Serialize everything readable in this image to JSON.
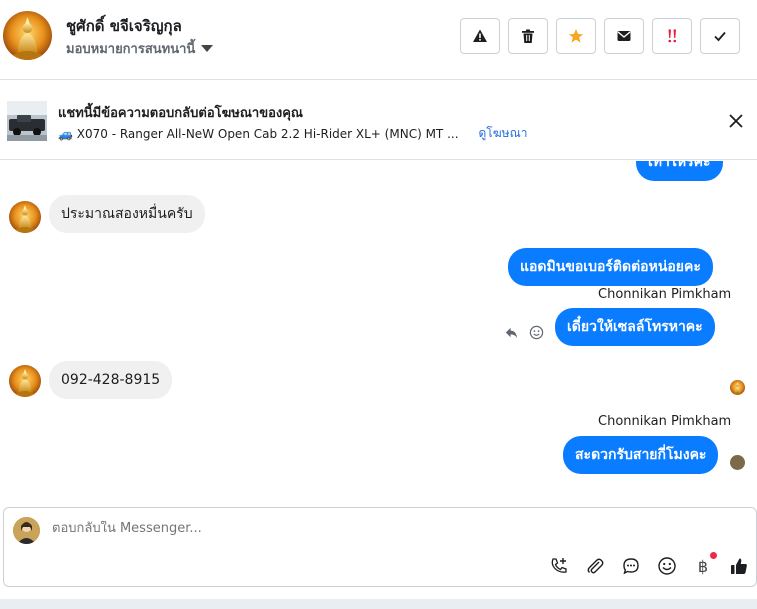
{
  "header": {
    "contact_name": "ชูศักดิ์ ขจีเจริญกุล",
    "assign_label": "มอบหมายการสนทนานี้",
    "actions": [
      "spam-icon",
      "trash-icon",
      "star-icon",
      "mail-icon",
      "urgent-icon",
      "check-icon"
    ],
    "accent_star": "#f5a623",
    "accent_urgent": "#e41e3f"
  },
  "ad_banner": {
    "title": "แชทนี้มีข้อความตอบกลับต่อโฆษณาของคุณ",
    "ad_text": "🚙 X070 - Ranger All-NeW Open Cab 2.2 Hi-Rider XL+ (MNC) MT ...",
    "view_ad": "ดูโฆษณา"
  },
  "messages": {
    "m0": "เท่าไหร่คะ",
    "m1": "ประมาณสองหมื่นครับ",
    "m2": "แอดมินขอเบอร์ติดต่อหน่อยคะ",
    "sender_a": "Chonnikan Pimkham",
    "m3": "เดี๋ยวให้เซลล์โทรหาคะ",
    "m4": "092-428-8915",
    "sender_b": "Chonnikan Pimkham",
    "m5": "สะดวกรับสายกี่โมงคะ"
  },
  "composer": {
    "placeholder": "ตอบกลับใน Messenger...",
    "baht": "฿",
    "tools": [
      "call-add-icon",
      "attachment-icon",
      "saved-reply-icon",
      "emoji-icon",
      "payment-icon",
      "like-icon"
    ]
  },
  "colors": {
    "outgoing_bubble": "#0a7cff",
    "incoming_bubble": "#f0f0f0",
    "link": "#216fdb"
  }
}
